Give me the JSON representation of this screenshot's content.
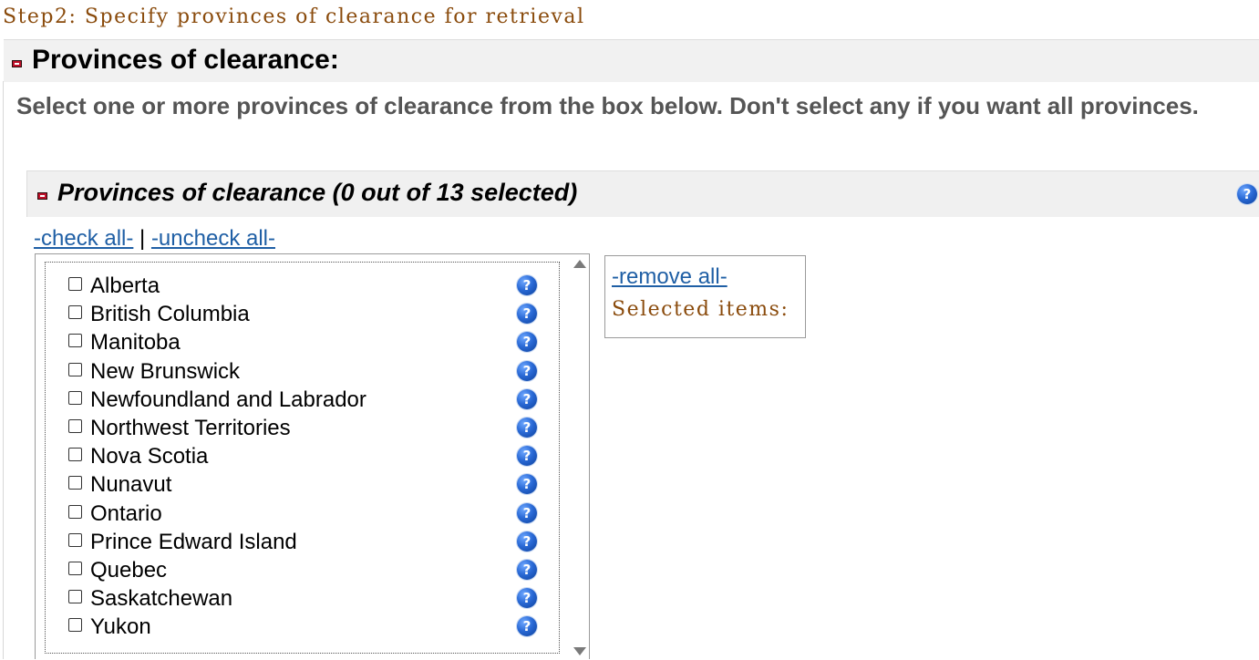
{
  "step": {
    "title": "Step2: Specify provinces of clearance for retrieval"
  },
  "section": {
    "title": "Provinces of clearance:"
  },
  "instructions": "Select one or more provinces of clearance from the box below. Don't select any if you want all provinces.",
  "subsection": {
    "title": "Provinces of clearance (0 out of 13 selected)"
  },
  "links": {
    "check_all": "-check all-",
    "separator": "|",
    "uncheck_all": "-uncheck all-"
  },
  "provinces": [
    {
      "label": "Alberta",
      "checked": false
    },
    {
      "label": "British Columbia",
      "checked": false
    },
    {
      "label": "Manitoba",
      "checked": false
    },
    {
      "label": "New Brunswick",
      "checked": false
    },
    {
      "label": "Newfoundland and Labrador",
      "checked": false
    },
    {
      "label": "Northwest Territories",
      "checked": false
    },
    {
      "label": "Nova Scotia",
      "checked": false
    },
    {
      "label": "Nunavut",
      "checked": false
    },
    {
      "label": "Ontario",
      "checked": false
    },
    {
      "label": "Prince Edward Island",
      "checked": false
    },
    {
      "label": "Quebec",
      "checked": false
    },
    {
      "label": "Saskatchewan",
      "checked": false
    },
    {
      "label": "Yukon",
      "checked": false
    }
  ],
  "selected_panel": {
    "remove_all": "-remove all-",
    "label": "Selected items:"
  },
  "icons": {
    "help": "?",
    "collapse": "minus-icon",
    "scroll_up": "arrow-up-icon",
    "scroll_down": "arrow-down-icon"
  },
  "colors": {
    "step_title": "#8a4b0c",
    "link": "#1f5fa5",
    "collapse": "#c0102a",
    "help": "#2a6ad6",
    "header_bg": "#f1f1f1"
  }
}
